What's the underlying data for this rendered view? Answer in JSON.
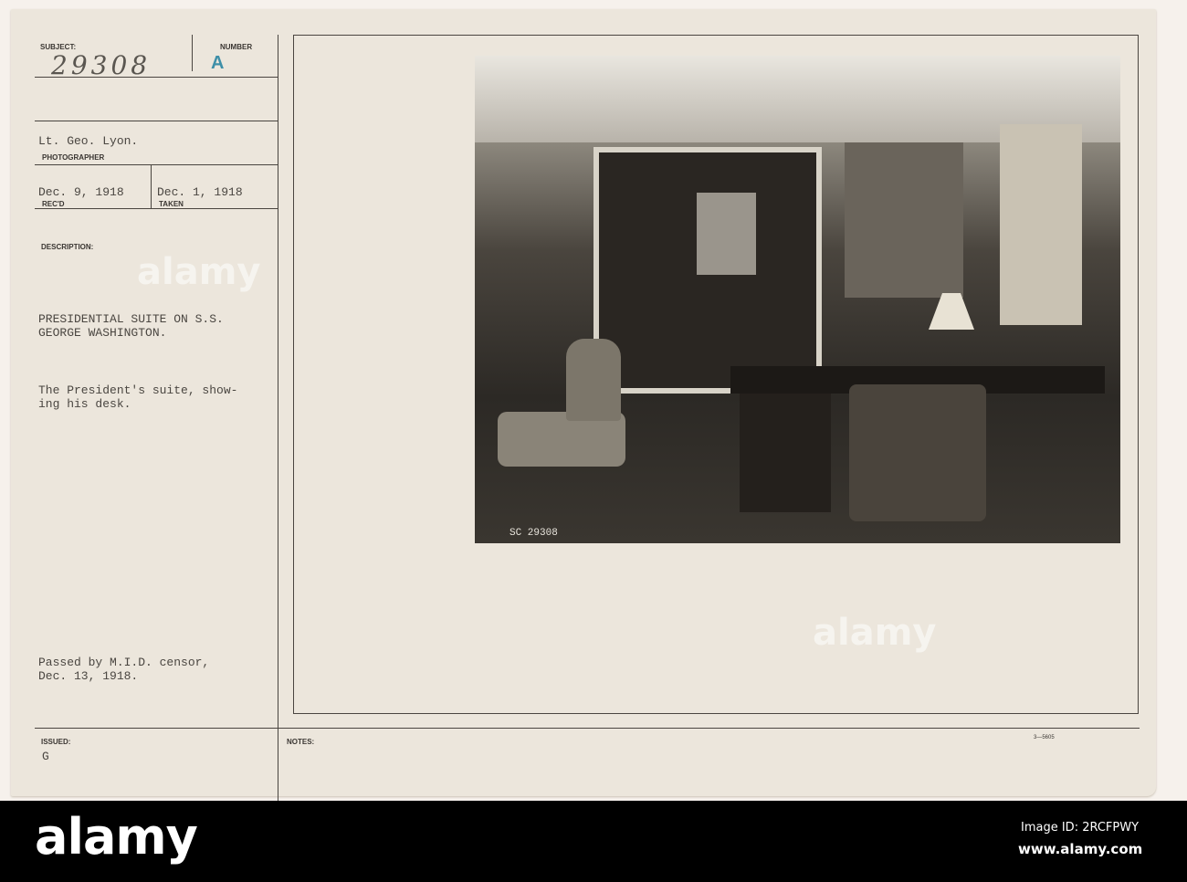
{
  "card": {
    "subject_label": "SUBJECT:",
    "subject_value": "29308",
    "number_label": "NUMBER",
    "number_value": "A",
    "photographer_value": "Lt. Geo. Lyon.",
    "photographer_label": "PHOTOGRAPHER",
    "recd_value": "Dec. 9, 1918",
    "recd_label": "REC'D",
    "taken_value": "Dec. 1, 1918",
    "taken_label": "TAKEN",
    "description_label": "DESCRIPTION:",
    "description_title": "PRESIDENTIAL SUITE ON S.S.\nGEORGE WASHINGTON.",
    "description_text": "The President's suite, show-\ning his desk.",
    "censor_text": "Passed by M.I.D. censor,\nDec. 13, 1918.",
    "issued_label": "ISSUED:",
    "issued_value": "G",
    "notes_label": "NOTES:",
    "form_number": "3—5605",
    "photo_caption": "SC 29308"
  },
  "watermark": "alamy",
  "footer": {
    "logo": "alamy",
    "image_id": "Image ID: 2RCFPWY",
    "url": "www.alamy.com"
  }
}
